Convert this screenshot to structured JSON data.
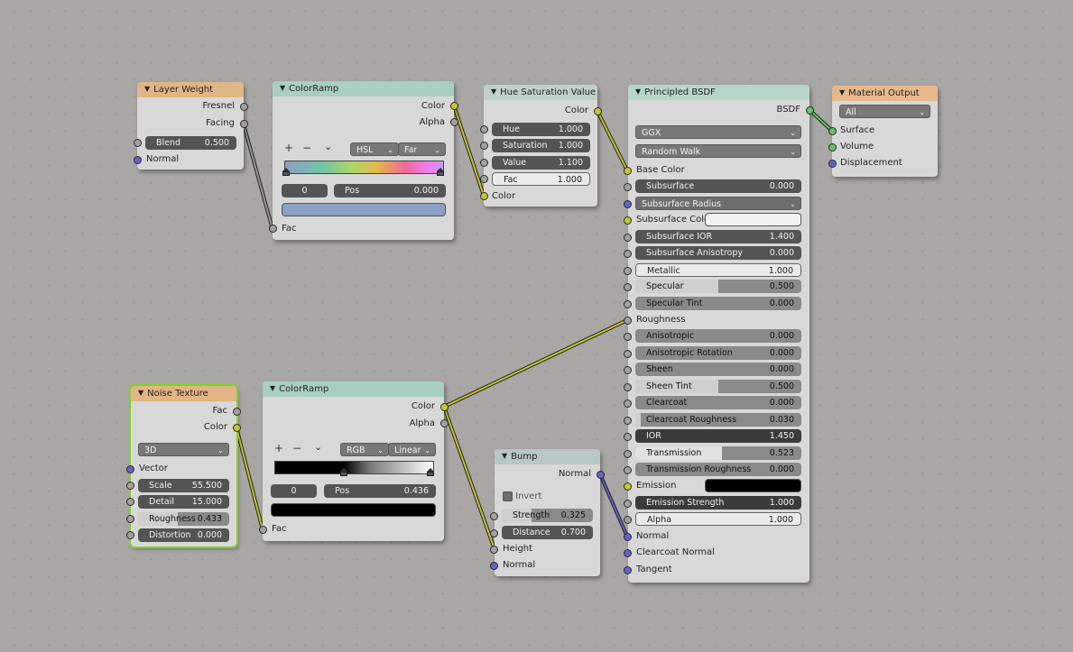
{
  "nodes": {
    "layer_weight": {
      "title": "Layer Weight",
      "out_fresnel": "Fresnel",
      "out_facing": "Facing",
      "blend_label": "Blend",
      "blend_value": "0.500",
      "in_normal": "Normal"
    },
    "colorramp1": {
      "title": "ColorRamp",
      "out_color": "Color",
      "out_alpha": "Alpha",
      "add": "+",
      "remove": "−",
      "menu": "⌄",
      "mode": "HSL",
      "interp": "Far",
      "stop_index": "0",
      "pos_label": "Pos",
      "pos_value": "0.000",
      "stop_color": "#8c9fc4",
      "in_fac": "Fac"
    },
    "hue_sat": {
      "title": "Hue Saturation Value",
      "out_color": "Color",
      "hue_label": "Hue",
      "hue_value": "1.000",
      "sat_label": "Saturation",
      "sat_value": "1.000",
      "val_label": "Value",
      "val_value": "1.100",
      "fac_label": "Fac",
      "fac_value": "1.000",
      "in_color": "Color"
    },
    "bsdf": {
      "title": "Principled BSDF",
      "out_bsdf": "BSDF",
      "distribution": "GGX",
      "subsurface_method": "Random Walk",
      "base_color": "Base Color",
      "subsurface_label": "Subsurface",
      "subsurface_value": "0.000",
      "subsurface_radius": "Subsurface Radius",
      "subsurface_color": "Subsurface Color",
      "sub_ior_label": "Subsurface IOR",
      "sub_ior_value": "1.400",
      "sub_aniso_label": "Subsurface Anisotropy",
      "sub_aniso_value": "0.000",
      "metallic_label": "Metallic",
      "metallic_value": "1.000",
      "specular_label": "Specular",
      "specular_value": "0.500",
      "spec_tint_label": "Specular Tint",
      "spec_tint_value": "0.000",
      "roughness": "Roughness",
      "aniso_label": "Anisotropic",
      "aniso_value": "0.000",
      "aniso_rot_label": "Anisotropic Rotation",
      "aniso_rot_value": "0.000",
      "sheen_label": "Sheen",
      "sheen_value": "0.000",
      "sheen_tint_label": "Sheen Tint",
      "sheen_tint_value": "0.500",
      "clearcoat_label": "Clearcoat",
      "clearcoat_value": "0.000",
      "cc_rough_label": "Clearcoat Roughness",
      "cc_rough_value": "0.030",
      "ior_label": "IOR",
      "ior_value": "1.450",
      "trans_label": "Transmission",
      "trans_value": "0.523",
      "trans_rough_label": "Transmission Roughness",
      "trans_rough_value": "0.000",
      "emission": "Emission",
      "emission_color": "#000000",
      "em_strength_label": "Emission Strength",
      "em_strength_value": "1.000",
      "alpha_label": "Alpha",
      "alpha_value": "1.000",
      "normal": "Normal",
      "clearcoat_normal": "Clearcoat Normal",
      "tangent": "Tangent"
    },
    "material_output": {
      "title": "Material Output",
      "target": "All",
      "surface": "Surface",
      "volume": "Volume",
      "displacement": "Displacement"
    },
    "noise": {
      "title": "Noise Texture",
      "out_fac": "Fac",
      "out_color": "Color",
      "dimensions": "3D",
      "in_vector": "Vector",
      "scale_label": "Scale",
      "scale_value": "55.500",
      "detail_label": "Detail",
      "detail_value": "15.000",
      "rough_label": "Roughness",
      "rough_value": "0.433",
      "distortion_label": "Distortion",
      "distortion_value": "0.000"
    },
    "colorramp2": {
      "title": "ColorRamp",
      "out_color": "Color",
      "out_alpha": "Alpha",
      "add": "+",
      "remove": "−",
      "menu": "⌄",
      "mode": "RGB",
      "interp": "Linear",
      "stop_index": "0",
      "pos_label": "Pos",
      "pos_value": "0.436",
      "stop_color": "#000000",
      "in_fac": "Fac"
    },
    "bump": {
      "title": "Bump",
      "out_normal": "Normal",
      "invert": "Invert",
      "strength_label": "Strength",
      "strength_value": "0.325",
      "distance_label": "Distance",
      "distance_value": "0.700",
      "in_height": "Height",
      "in_normal": "Normal"
    }
  },
  "colors": {
    "socket_float": "#a1a1a1",
    "socket_color": "#c7c729",
    "socket_vector": "#6363c7",
    "socket_shader": "#63c763",
    "active_outline": "#7ed321"
  }
}
